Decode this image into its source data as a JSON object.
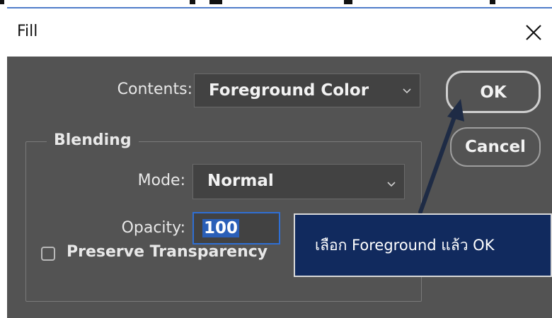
{
  "window": {
    "title": "Fill",
    "close_icon": "close-icon"
  },
  "contents": {
    "label": "Contents:",
    "selected": "Foreground Color"
  },
  "blending": {
    "legend": "Blending",
    "mode_label": "Mode:",
    "mode_selected": "Normal",
    "opacity_label": "Opacity:",
    "opacity_value": "100",
    "preserve_label": "Preserve Transparency",
    "preserve_checked": false
  },
  "buttons": {
    "ok": "OK",
    "cancel": "Cancel"
  },
  "annotation": {
    "text": "เลือก Foreground แล้ว OK"
  },
  "colors": {
    "dialog_bg": "#535353",
    "field_bg": "#424242",
    "focus": "#2f6fd4",
    "annotation_bg": "#112a5e"
  }
}
